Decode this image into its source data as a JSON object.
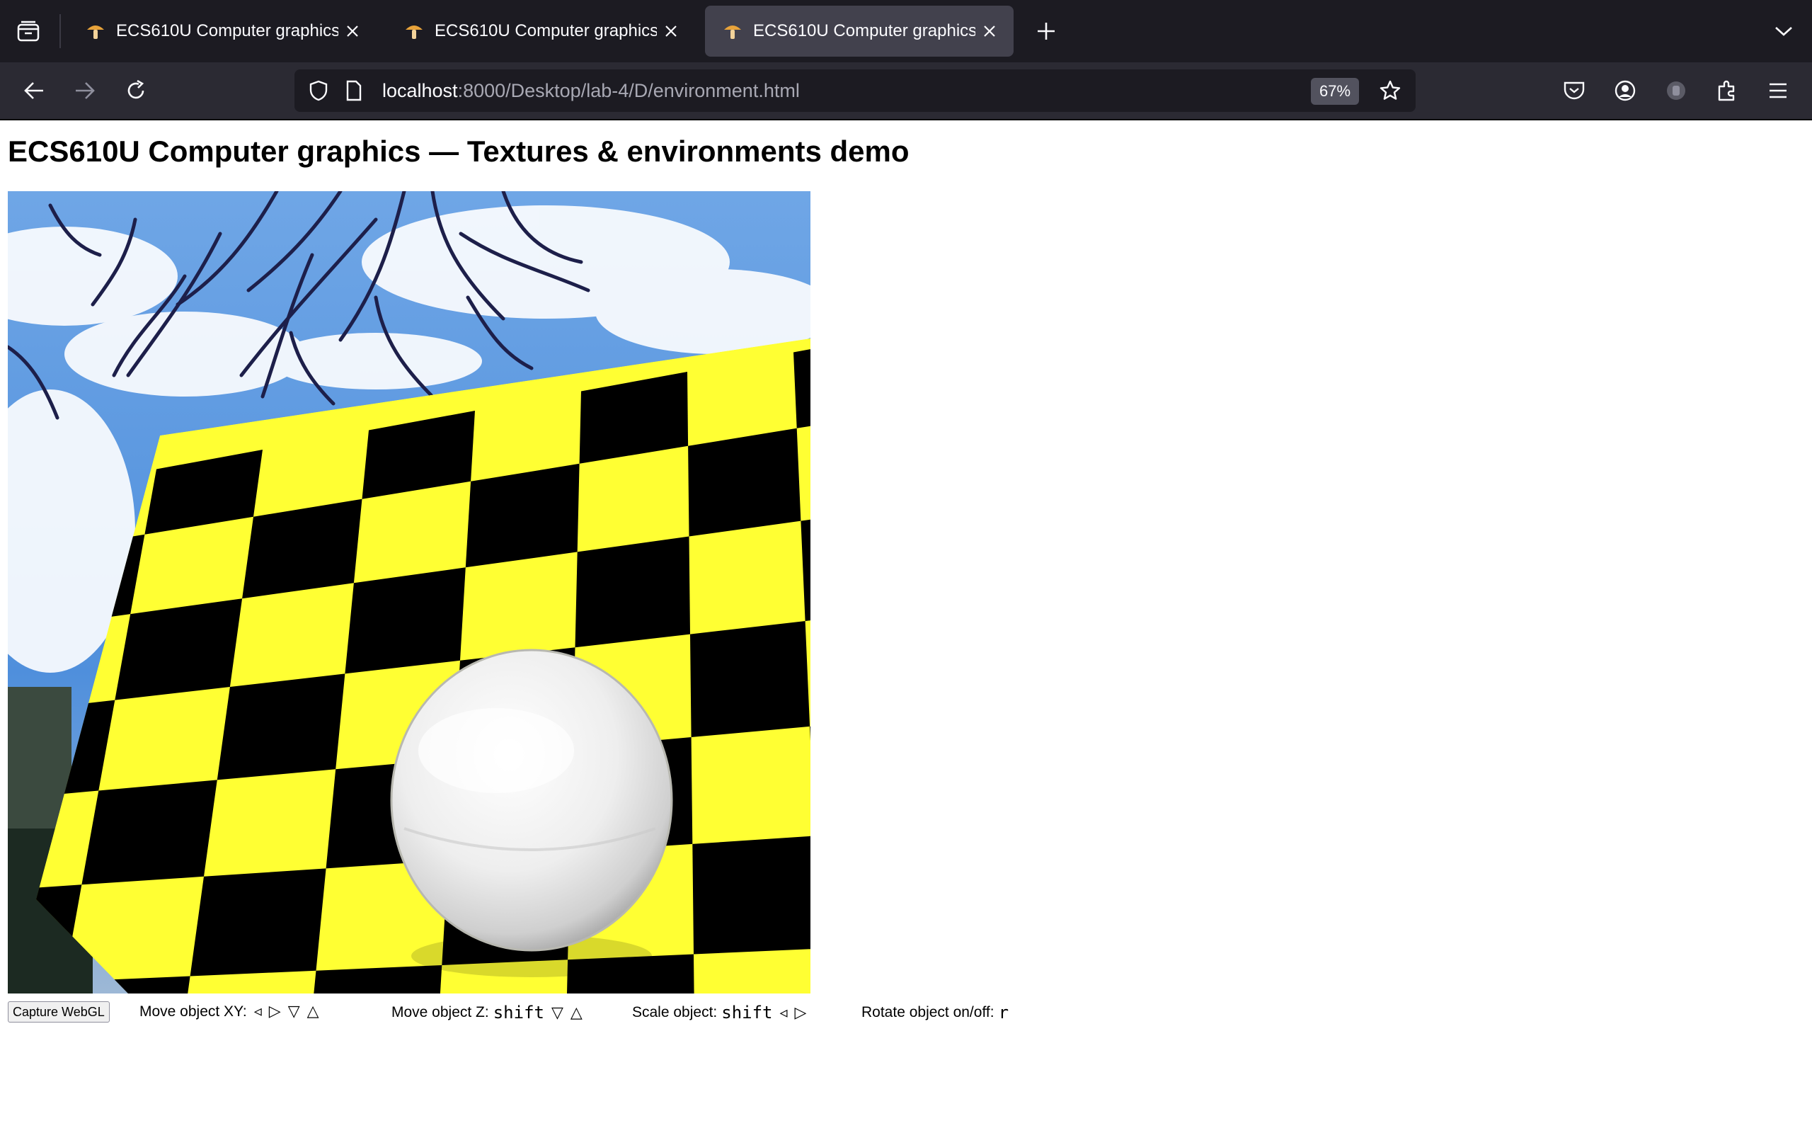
{
  "browser": {
    "tabs": [
      {
        "title": "ECS610U Computer graphics",
        "active": false
      },
      {
        "title": "ECS610U Computer graphics",
        "active": false
      },
      {
        "title": "ECS610U Computer graphics",
        "active": true
      }
    ],
    "url_host": "localhost",
    "url_path": ":8000/Desktop/lab-4/D/environment.html",
    "zoom": "67%"
  },
  "page": {
    "title": "ECS610U Computer graphics — Textures & environments demo"
  },
  "controls": {
    "capture_label": "Capture WebGL",
    "move_xy_label": "Move object XY:",
    "move_xy_keys": [
      "◃",
      "▷",
      "▽",
      "△"
    ],
    "move_z_label": "Move object Z:",
    "move_z_modifier": "shift",
    "move_z_keys": [
      "▽",
      "△"
    ],
    "scale_label": "Scale object:",
    "scale_modifier": "shift",
    "scale_keys": [
      "◃",
      "▷"
    ],
    "rotate_label": "Rotate object on/off:",
    "rotate_key": "r"
  },
  "colors": {
    "checker_yellow": "#ffff33",
    "checker_black": "#000000",
    "sky": "#5b95dc"
  }
}
